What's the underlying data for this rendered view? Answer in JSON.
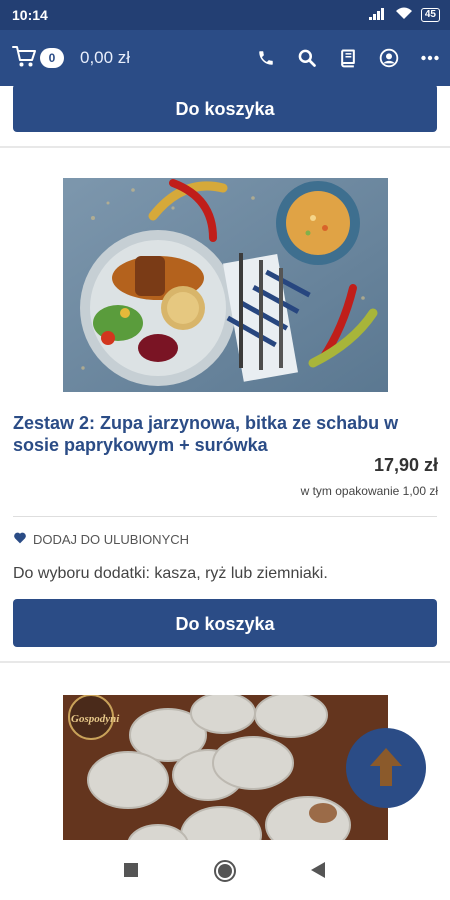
{
  "status_bar": {
    "time": "10:14",
    "battery": "45",
    "icons": [
      "signal-icon",
      "wifi-icon",
      "battery-icon"
    ]
  },
  "app_bar": {
    "cart_count": "0",
    "cart_total": "0,00 zł",
    "icons": [
      "cart-icon",
      "phone-icon",
      "search-icon",
      "book-icon",
      "account-icon",
      "more-icon"
    ]
  },
  "products": [
    {
      "add_to_cart_label": "Do koszyka"
    },
    {
      "image_icon": "food-photo",
      "title": "Zestaw 2: Zupa jarzynowa, bitka ze schabu w sosie paprykowym + surówka",
      "price": "17,90 zł",
      "packaging_note": "w tym opakowanie 1,00 zł",
      "favorite_label": "DODAJ DO ULUBIONYCH",
      "description": "Do wyboru dodatki: kasza, ryż lub ziemniaki.",
      "add_to_cart_label": "Do koszyka"
    },
    {
      "image_icon": "dumplings-photo",
      "brand_watermark": "Gospodyni"
    }
  ],
  "colors": {
    "primary": "#2b4c86",
    "status_bar": "#233f73",
    "price_text": "#333333"
  },
  "nav_bar": {
    "icons": [
      "recents-icon",
      "home-icon",
      "back-icon"
    ]
  }
}
